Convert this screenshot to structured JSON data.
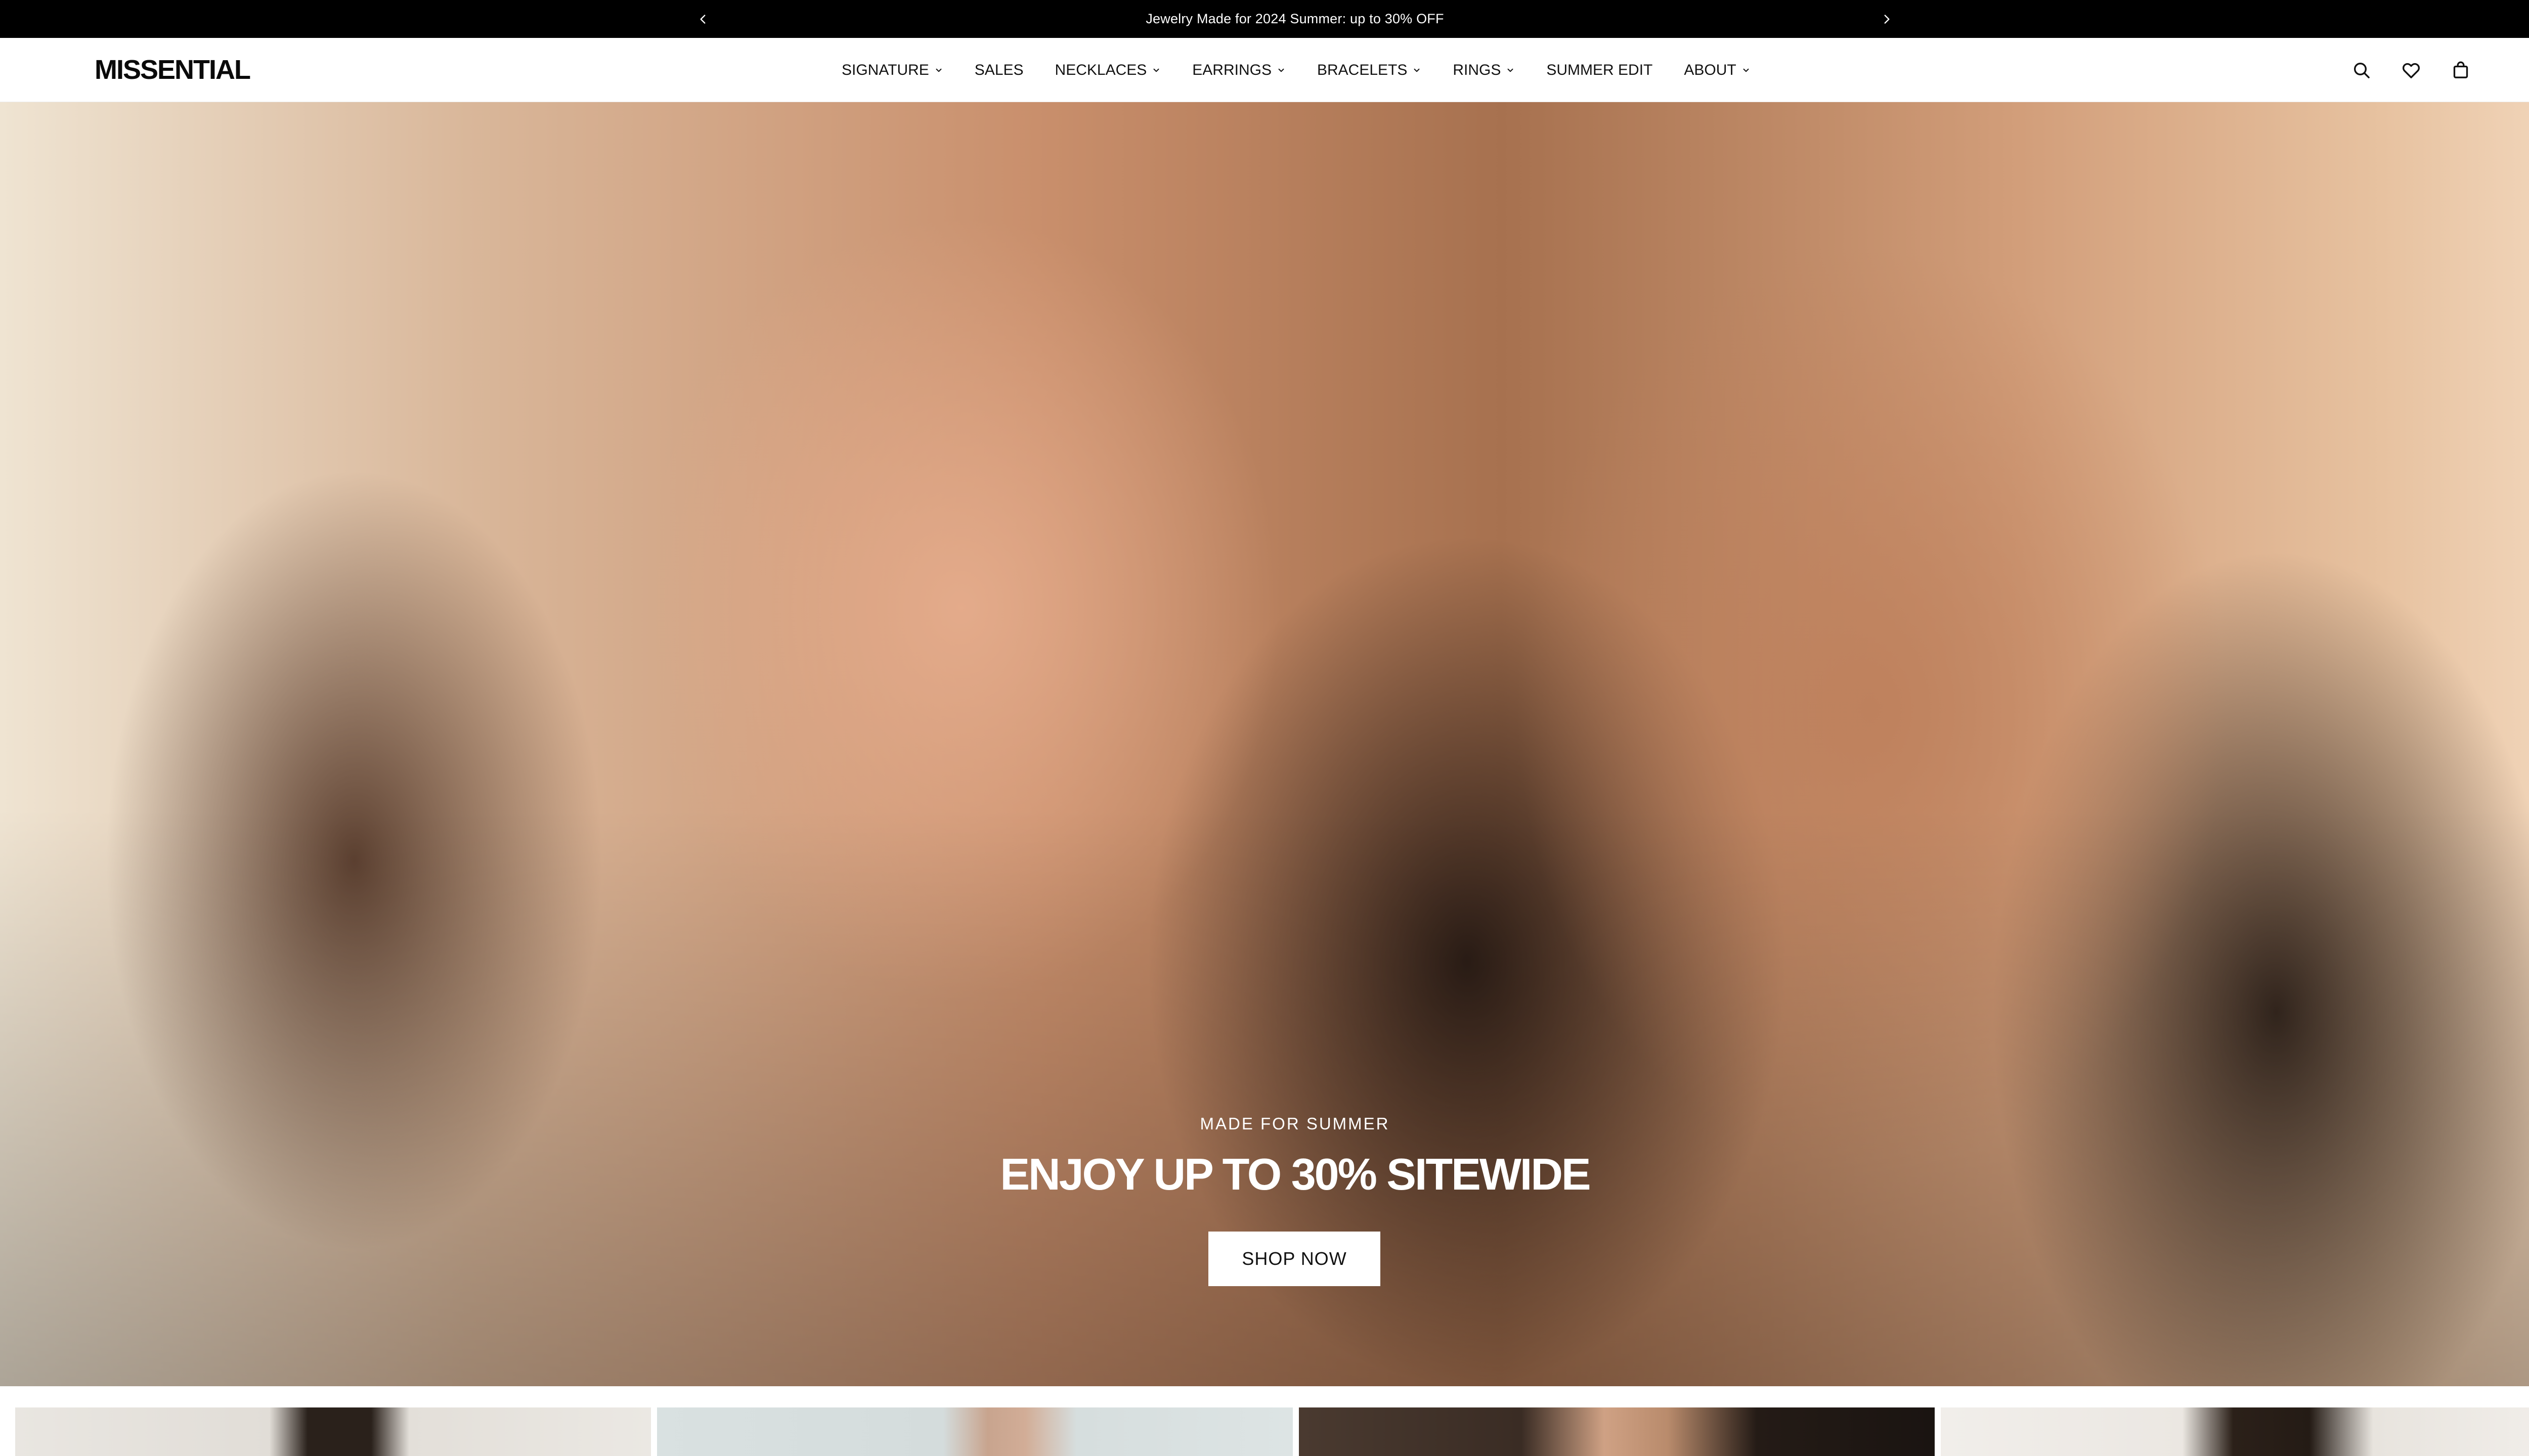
{
  "announcement": {
    "text": "Jewelry Made for 2024 Summer: up to 30% OFF",
    "prev_icon": "chevron-left-icon",
    "next_icon": "chevron-right-icon"
  },
  "header": {
    "logo": "MISSENTIAL",
    "nav": [
      {
        "label": "SIGNATURE",
        "has_dropdown": true
      },
      {
        "label": "SALES",
        "has_dropdown": false
      },
      {
        "label": "NECKLACES",
        "has_dropdown": true
      },
      {
        "label": "EARRINGS",
        "has_dropdown": true
      },
      {
        "label": "BRACELETS",
        "has_dropdown": true
      },
      {
        "label": "RINGS",
        "has_dropdown": true
      },
      {
        "label": "SUMMER EDIT",
        "has_dropdown": false
      },
      {
        "label": "ABOUT",
        "has_dropdown": true
      }
    ],
    "icons": [
      "search-icon",
      "heart-icon",
      "shopping-bag-icon"
    ]
  },
  "hero": {
    "subtitle": "MADE FOR SUMMER",
    "title": "ENJOY UP TO 30% SITEWIDE",
    "cta": "SHOP NOW"
  },
  "colors": {
    "announcement_bg": "#000000",
    "header_bg": "#ffffff",
    "text": "#111111",
    "button_bg": "#ffffff"
  }
}
